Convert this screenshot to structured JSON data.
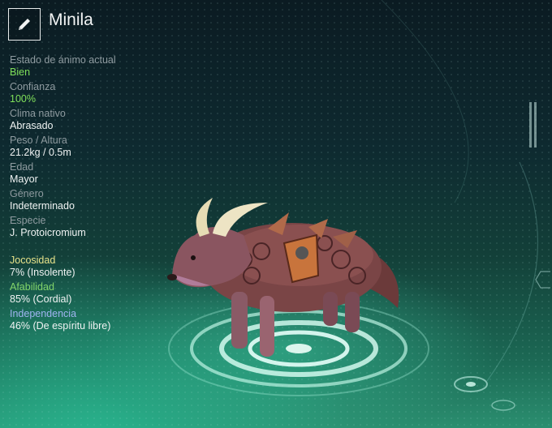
{
  "pet": {
    "name": "Minila"
  },
  "icons": {
    "edit": "pencil-icon"
  },
  "stats": [
    {
      "label": "Estado de ánimo actual",
      "value": "Bien",
      "value_color": "green"
    },
    {
      "label": "Confianza",
      "value": "100%",
      "value_color": "green"
    },
    {
      "label": "Clima nativo",
      "value": "Abrasado"
    },
    {
      "label": "Peso / Altura",
      "value": "21.2kg / 0.5m"
    },
    {
      "label": "Edad",
      "value": "Mayor"
    },
    {
      "label": "Género",
      "value": "Indeterminado"
    },
    {
      "label": "Especie",
      "value": "J. Protoicromium"
    }
  ],
  "traits": [
    {
      "label": "Jocosidad",
      "value": "7% (Insolente)",
      "label_color": "#e8e38a"
    },
    {
      "label": "Afabilidad",
      "value": "85% (Cordial)",
      "label_color": "#82d46a"
    },
    {
      "label": "Independencia",
      "value": "46% (De espíritu libre)",
      "label_color": "#9fb4f0"
    }
  ]
}
